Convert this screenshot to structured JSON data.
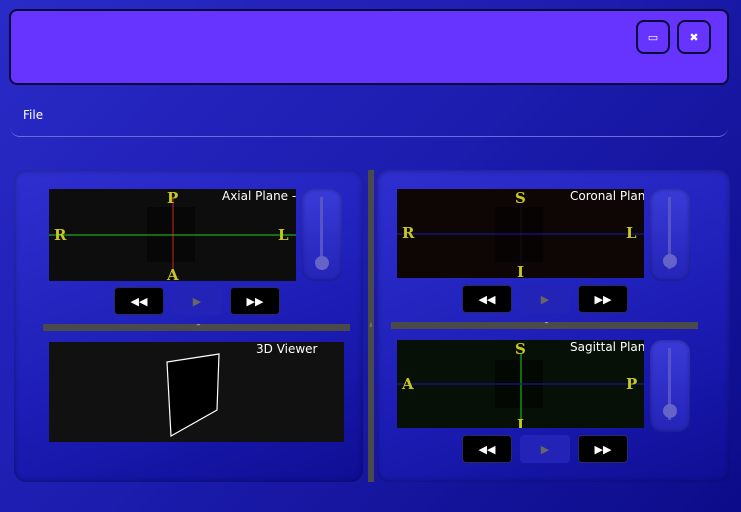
{
  "window": {
    "maximize_icon": "maximize-icon",
    "close_icon": "close-icon",
    "maximize_glyph": "▭",
    "close_glyph": "✖"
  },
  "menu": {
    "file": "File"
  },
  "controls": {
    "rewind_glyph": "◀◀",
    "play_glyph": "▶",
    "forward_glyph": "▶▶"
  },
  "axial": {
    "title": "Axial Plane - X",
    "top": "P",
    "bottom": "A",
    "left": "R",
    "right": "L",
    "slider_level": 0.0
  },
  "coronal": {
    "title": "Coronal Plane",
    "top": "S",
    "bottom": "I",
    "left": "R",
    "right": "L",
    "slider_level": 0.0
  },
  "sagittal": {
    "title": "Sagittal Plane",
    "top": "S",
    "bottom": "I",
    "left": "A",
    "right": "P",
    "slider_level": 0.0
  },
  "viewer3d": {
    "title": "3D Viewer"
  },
  "colors": {
    "label": "#c8c820",
    "vertical_axial": "#cc2222",
    "horizontal_axial": "#22cc22",
    "coronal_line": "#1a1aaa",
    "sagittal_vertical": "#22cc22"
  }
}
